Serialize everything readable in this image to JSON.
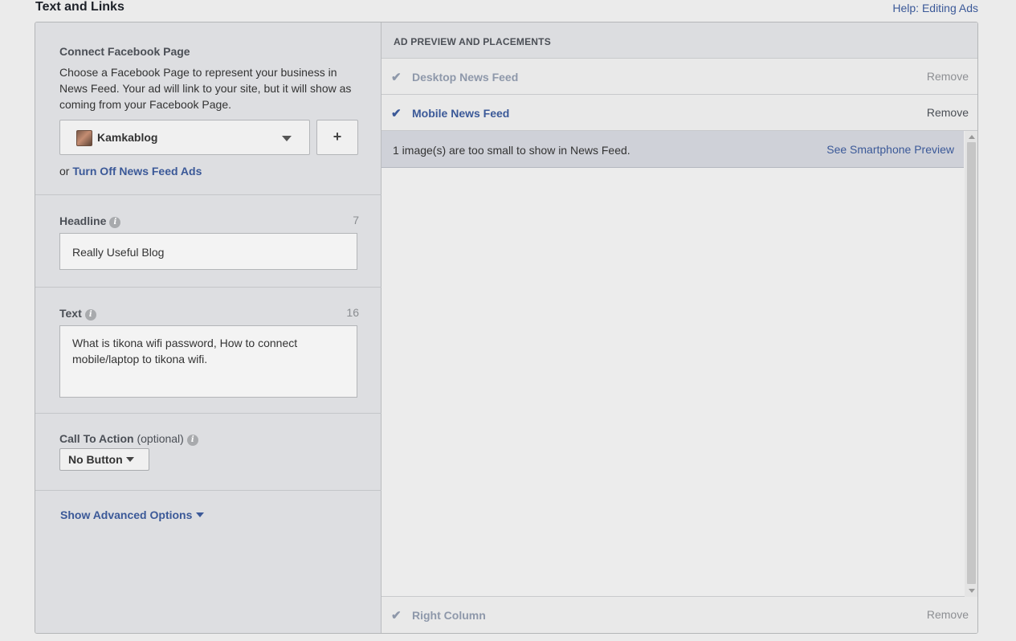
{
  "header": {
    "title": "Text and Links",
    "help_link": "Help: Editing Ads"
  },
  "connect_page": {
    "title": "Connect Facebook Page",
    "description": "Choose a Facebook Page to represent your business in News Feed. Your ad will link to your site, but it will show as coming from your Facebook Page.",
    "selected_page": "Kamkablog",
    "add_button": "+",
    "or_text": "or",
    "turn_off_link": "Turn Off News Feed Ads"
  },
  "headline": {
    "label": "Headline",
    "count": "7",
    "value": "Really Useful Blog"
  },
  "text": {
    "label": "Text",
    "count": "16",
    "value": "What is tikona wifi password, How to connect mobile/laptop to tikona wifi."
  },
  "call_to_action": {
    "label": "Call To Action",
    "optional": "(optional)",
    "selected": "No Button"
  },
  "advanced": {
    "label": "Show Advanced Options"
  },
  "preview": {
    "header": "AD PREVIEW AND PLACEMENTS",
    "placements": [
      {
        "name": "Desktop News Feed",
        "remove": "Remove",
        "active": false
      },
      {
        "name": "Mobile News Feed",
        "remove": "Remove",
        "active": true
      },
      {
        "name": "Right Column",
        "remove": "Remove",
        "active": false
      }
    ],
    "warning": "1 image(s) are too small to show in News Feed.",
    "smartphone_link": "See Smartphone Preview"
  },
  "icons": {
    "check": "check-icon",
    "info": "info-icon",
    "caret": "caret-down-icon"
  },
  "colors": {
    "link": "#3b5998",
    "panel": "#dddee1",
    "warning_bar": "#cfd1d8"
  }
}
